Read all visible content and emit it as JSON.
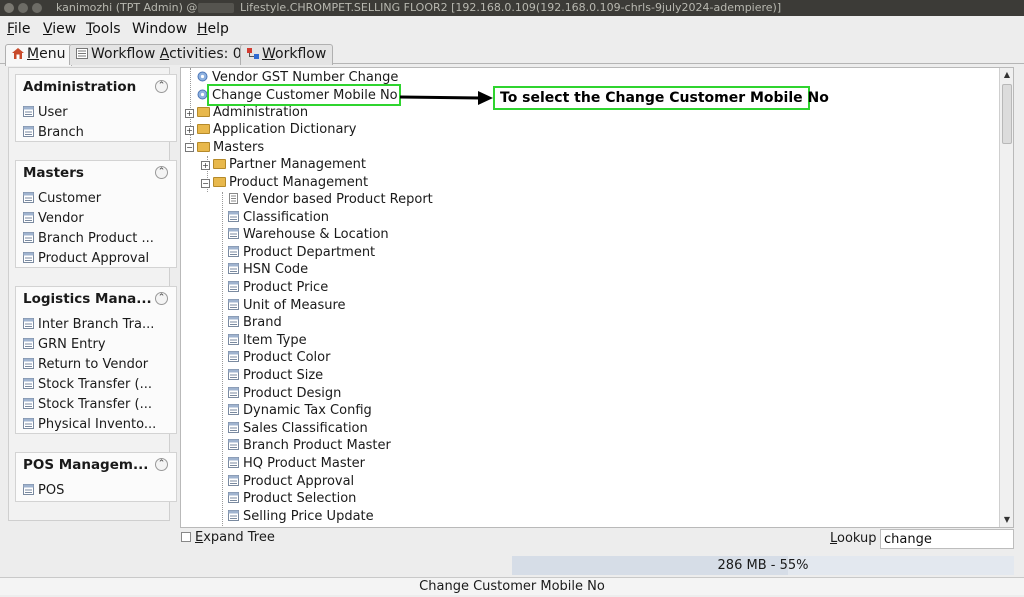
{
  "window": {
    "user": "kanimozhi (TPT Admin) @",
    "title": "Lifestyle.CHROMPET.SELLING FLOOR2 [192.168.0.109(192.168.0.109-chrls-9july2024-adempiere)]"
  },
  "menubar": {
    "file": {
      "u": "F",
      "rest": "ile"
    },
    "view": {
      "u": "V",
      "rest": "iew"
    },
    "tools": {
      "u": "T",
      "rest": "ools"
    },
    "window": {
      "pre": "Window"
    },
    "help": {
      "u": "H",
      "rest": "elp"
    }
  },
  "tabs": {
    "menu": {
      "u": "M",
      "rest": "enu"
    },
    "workflow_activities": {
      "pre": "Workflow ",
      "u": "A",
      "rest": "ctivities: 0"
    },
    "workflow": {
      "u": "W",
      "rest": "orkflow"
    }
  },
  "sidebar": {
    "groups": [
      {
        "title": "Administration",
        "items": [
          "User",
          "Branch"
        ]
      },
      {
        "title": "Masters",
        "items": [
          "Customer",
          "Vendor",
          "Branch Product ...",
          "Product Approval"
        ]
      },
      {
        "title": "Logistics Mana...",
        "items": [
          "Inter Branch Tra...",
          "GRN Entry",
          "Return to Vendor",
          "Stock Transfer (...",
          "Stock Transfer (...",
          "Physical Invento..."
        ]
      },
      {
        "title": "POS Managem...",
        "items": [
          "POS"
        ]
      }
    ]
  },
  "tree": {
    "n0": "Vendor GST Number Change",
    "n1": "Change Customer Mobile No",
    "n2": "Administration",
    "n3": "Application Dictionary",
    "n4": "Masters",
    "n5": "Partner Management",
    "n6": "Product Management",
    "children": [
      "Vendor based Product Report",
      "Classification",
      "Warehouse & Location",
      "Product Department",
      "HSN Code",
      "Product Price",
      "Unit of Measure",
      "Brand",
      "Item Type",
      "Product Color",
      "Product Size",
      "Product Design",
      "Dynamic Tax Config",
      "Sales Classification",
      "Branch Product Master",
      "HQ Product Master",
      "Product Approval",
      "Product Selection",
      "Selling Price Update"
    ]
  },
  "annotation": {
    "callout": "To select the Change Customer Mobile No",
    "color": "#2fd42f"
  },
  "footer": {
    "expand_tree": {
      "u": "E",
      "rest": "xpand Tree"
    },
    "lookup": {
      "u": "L",
      "rest": "ookup"
    },
    "lookup_value": "change",
    "memory": "286 MB - 55%",
    "memory_fraction": 0.55,
    "status": "Change Customer Mobile No"
  }
}
